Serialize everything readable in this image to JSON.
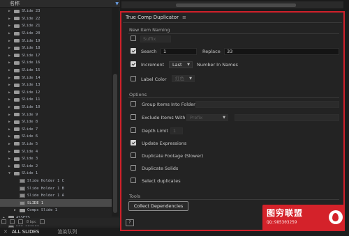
{
  "project": {
    "column_label": "名称",
    "tree": [
      {
        "label": "Slide 23",
        "type": "folder",
        "indent": 1,
        "expanded": false
      },
      {
        "label": "Slide 22",
        "type": "folder",
        "indent": 1,
        "expanded": false
      },
      {
        "label": "Slide 21",
        "type": "folder",
        "indent": 1,
        "expanded": false
      },
      {
        "label": "Slide 20",
        "type": "folder",
        "indent": 1,
        "expanded": false
      },
      {
        "label": "Slide 19",
        "type": "folder",
        "indent": 1,
        "expanded": false
      },
      {
        "label": "Slide 18",
        "type": "folder",
        "indent": 1,
        "expanded": false
      },
      {
        "label": "Slide 17",
        "type": "folder",
        "indent": 1,
        "expanded": false
      },
      {
        "label": "Slide 16",
        "type": "folder",
        "indent": 1,
        "expanded": false
      },
      {
        "label": "Slide 15",
        "type": "folder",
        "indent": 1,
        "expanded": false
      },
      {
        "label": "Slide 14",
        "type": "folder",
        "indent": 1,
        "expanded": false
      },
      {
        "label": "Slide 13",
        "type": "folder",
        "indent": 1,
        "expanded": false
      },
      {
        "label": "Slide 12",
        "type": "folder",
        "indent": 1,
        "expanded": false
      },
      {
        "label": "Slide 11",
        "type": "folder",
        "indent": 1,
        "expanded": false
      },
      {
        "label": "Slide 10",
        "type": "folder",
        "indent": 1,
        "expanded": false
      },
      {
        "label": "Slide 9",
        "type": "folder",
        "indent": 1,
        "expanded": false
      },
      {
        "label": "Slide 8",
        "type": "folder",
        "indent": 1,
        "expanded": false
      },
      {
        "label": "Slide 7",
        "type": "folder",
        "indent": 1,
        "expanded": false
      },
      {
        "label": "Slide 6",
        "type": "folder",
        "indent": 1,
        "expanded": false
      },
      {
        "label": "Slide 5",
        "type": "folder",
        "indent": 1,
        "expanded": false
      },
      {
        "label": "Slide 4",
        "type": "folder",
        "indent": 1,
        "expanded": false
      },
      {
        "label": "Slide 3",
        "type": "folder",
        "indent": 1,
        "expanded": false
      },
      {
        "label": "Slide 2",
        "type": "folder",
        "indent": 1,
        "expanded": false
      },
      {
        "label": "Slide 1",
        "type": "folder",
        "indent": 1,
        "expanded": true
      },
      {
        "label": "Slide Holder 1 C",
        "type": "comp",
        "indent": 2
      },
      {
        "label": "Slide Holder 1 B",
        "type": "comp",
        "indent": 2
      },
      {
        "label": "Slide Holder 1 A",
        "type": "comp",
        "indent": 2
      },
      {
        "label": "SLIDE 1",
        "type": "comp",
        "indent": 2,
        "selected": true
      },
      {
        "label": "Comps Slide 1",
        "type": "folder",
        "indent": 2,
        "expanded": false
      },
      {
        "label": "ASSETS",
        "type": "folder",
        "indent": 0,
        "expanded": false
      },
      {
        "label": "ALL SLIDES",
        "type": "comp",
        "indent": 0
      }
    ],
    "toolbar_bpc": "8 bpc"
  },
  "bottom_tabs": {
    "all_slides": "ALL SLIDES",
    "render_queue": "渲染队列"
  },
  "panel": {
    "title": "True Comp Duplicator",
    "new_item_naming": {
      "heading": "New Item Naming",
      "suffix": {
        "checked": false,
        "value": "Suffix"
      },
      "search": {
        "checked": true,
        "label": "Search",
        "search_value": "1",
        "replace_label": "Replace",
        "replace_value": "33"
      },
      "increment": {
        "checked": true,
        "label": "Increment",
        "mode": "Last",
        "after_label": "Number In Names"
      },
      "label_color": {
        "checked": false,
        "label": "Label Color",
        "value": "红色"
      }
    },
    "options": {
      "heading": "Options",
      "items": [
        {
          "label": "Group Items Into Folder",
          "checked": false
        },
        {
          "label": "Exclude Items With",
          "checked": false,
          "select": "Prefix"
        },
        {
          "label": "Depth Limit",
          "checked": false,
          "value": "1"
        },
        {
          "label": "Update Expressions",
          "checked": true
        },
        {
          "label": "Duplicate Footage (Slower)",
          "checked": false
        },
        {
          "label": "Duplicate Solids",
          "checked": false
        },
        {
          "label": "Select duplicates",
          "checked": false
        }
      ]
    },
    "tools": {
      "heading": "Tools",
      "collect_button": "Collect Dependencies",
      "help_button": "?",
      "duplicate_button_partial": "ed"
    }
  },
  "watermark": {
    "title": "图穷联盟",
    "subtitle": "QQ:985303259"
  },
  "colors": {
    "panel_border": "#d0202a",
    "background": "#232323",
    "watermark_bg": "#d4222a"
  }
}
